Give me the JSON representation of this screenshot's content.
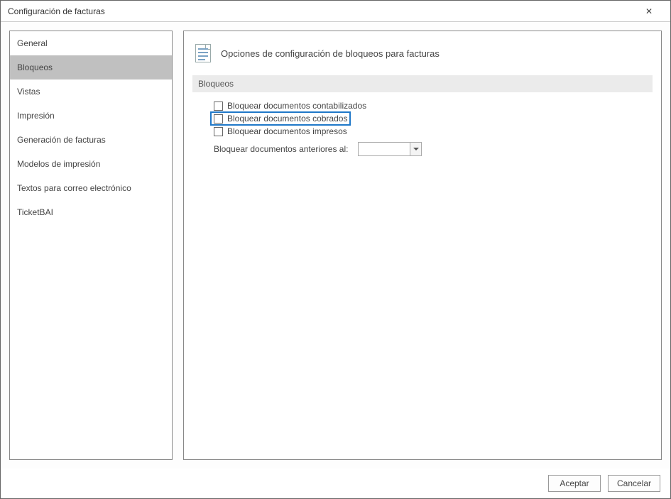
{
  "title": "Configuración de facturas",
  "sidebar": {
    "items": [
      {
        "label": "General",
        "selected": false
      },
      {
        "label": "Bloqueos",
        "selected": true
      },
      {
        "label": "Vistas",
        "selected": false
      },
      {
        "label": "Impresión",
        "selected": false
      },
      {
        "label": "Generación de facturas",
        "selected": false
      },
      {
        "label": "Modelos de impresión",
        "selected": false
      },
      {
        "label": "Textos para correo electrónico",
        "selected": false
      },
      {
        "label": "TicketBAI",
        "selected": false
      }
    ]
  },
  "main": {
    "heading": "Opciones de configuración de bloqueos para facturas",
    "section_label": "Bloqueos",
    "options": {
      "opt1": "Bloquear documentos contabilizados",
      "opt2": "Bloquear documentos cobrados",
      "opt3": "Bloquear documentos impresos",
      "date_label": "Bloquear documentos anteriores al:",
      "date_value": ""
    }
  },
  "footer": {
    "accept": "Aceptar",
    "cancel": "Cancelar"
  }
}
